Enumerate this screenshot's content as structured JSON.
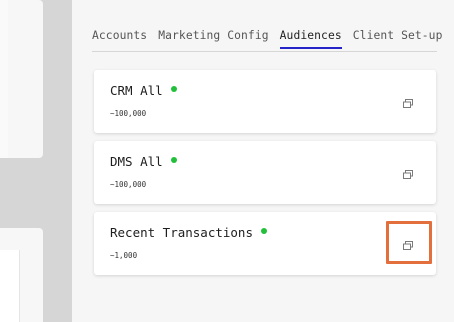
{
  "tabs": [
    {
      "label": "Accounts",
      "active": false
    },
    {
      "label": "Marketing Config",
      "active": false
    },
    {
      "label": "Audiences",
      "active": true
    },
    {
      "label": "Client Set-up",
      "active": false
    }
  ],
  "audiences": [
    {
      "name": "CRM All",
      "count": "~100,000",
      "status_color": "#22c03a",
      "icon": "copy-icon"
    },
    {
      "name": "DMS All",
      "count": "~100,000",
      "status_color": "#22c03a",
      "icon": "copy-icon"
    },
    {
      "name": "Recent Transactions",
      "count": "~1,000",
      "status_color": "#22c03a",
      "icon": "copy-icon",
      "highlighted": true
    }
  ],
  "colors": {
    "active_tab_underline": "#2424c9",
    "highlight_border": "#e26f3c",
    "status_dot": "#22c03a"
  }
}
